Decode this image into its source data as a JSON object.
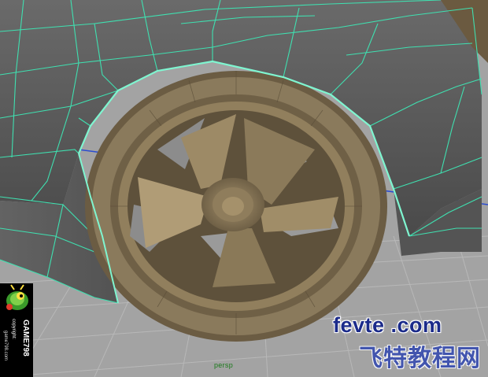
{
  "viewport": {
    "camera_label": "persp",
    "colors": {
      "background": "#a3a3a3",
      "grid": "#b9b9b9",
      "wireframe": "#40e0b0",
      "body_shade": "#5a5a5a",
      "wheel": "#7d6e52"
    }
  },
  "watermark": {
    "site_url": "fevte .com",
    "site_name": "飞特教程网"
  },
  "logo": {
    "name": "GAME798",
    "copyright": "copyright:  ",
    "url": "game798.com",
    "icon": "bug-mascot-icon"
  }
}
